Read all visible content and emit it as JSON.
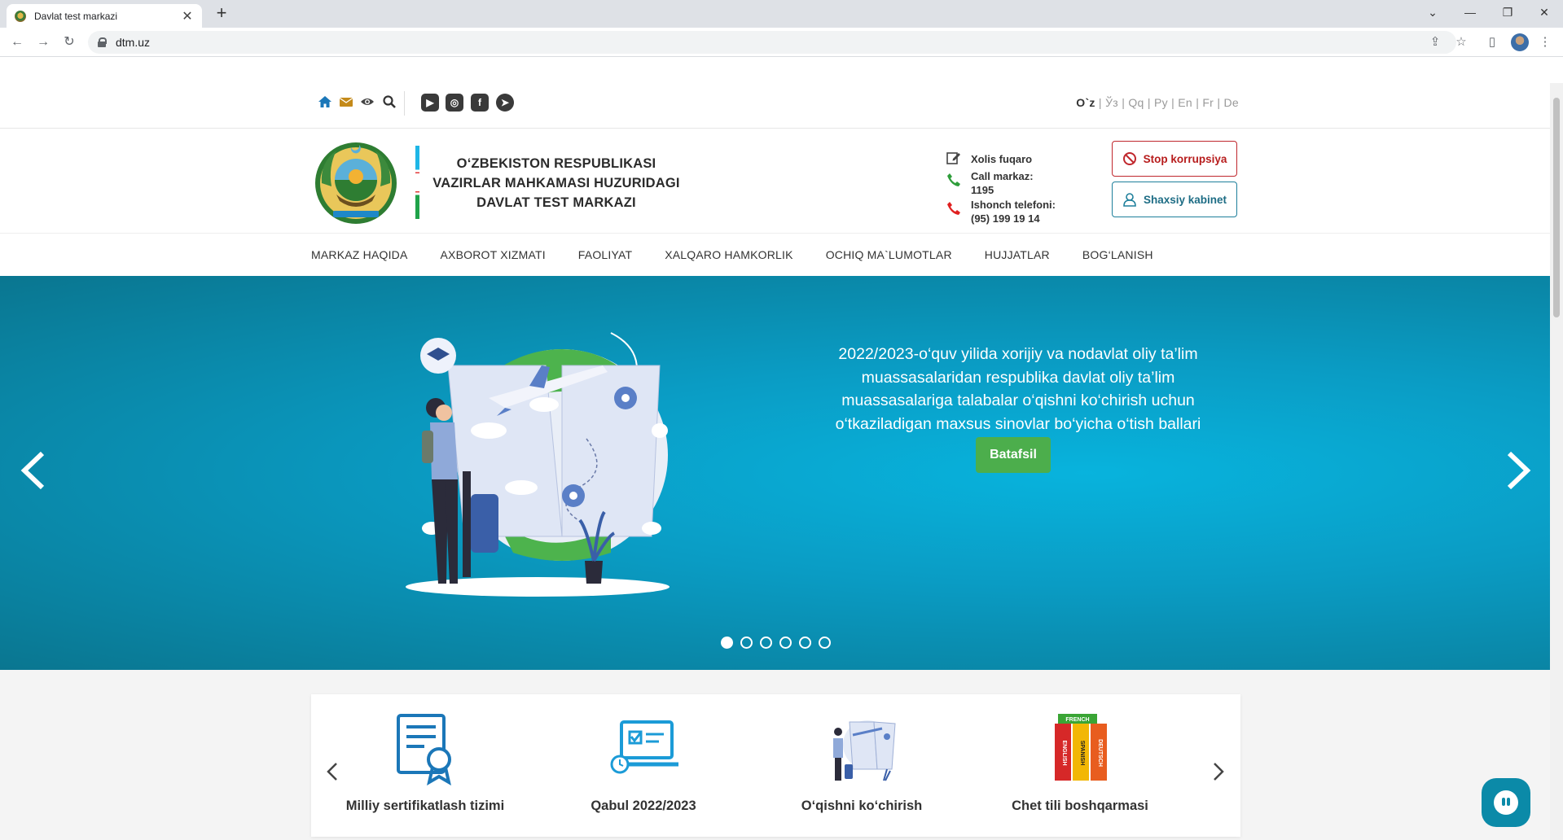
{
  "browser": {
    "tab_title": "Davlat test markazi",
    "url": "dtm.uz"
  },
  "topbar": {
    "languages": [
      "O`z",
      "Ўз",
      "Qq",
      "Ру",
      "En",
      "Fr",
      "De"
    ],
    "active_language": "O`z",
    "social_icons": [
      "youtube-icon",
      "instagram-icon",
      "facebook-icon",
      "telegram-icon"
    ],
    "utility_icons": [
      "home-icon",
      "mail-icon",
      "eye-icon",
      "search-icon"
    ]
  },
  "header": {
    "org_line1": "O‘ZBEKISTON RESPUBLIKASI",
    "org_line2": "VAZIRLAR MAHKAMASI HUZURIDAGI",
    "org_line3": "DAVLAT TEST MARKAZI",
    "contact": {
      "xolis": "Xolis fuqaro",
      "call_label": "Call markaz:",
      "call_value": "1195",
      "trust_label": "Ishonch telefoni:",
      "trust_value": "(95) 199 19 14"
    },
    "stop_label": "Stop korrupsiya",
    "cabinet_label": "Shaxsiy kabinet"
  },
  "nav": [
    {
      "label": "MARKAZ HAQIDA"
    },
    {
      "label": "AXBOROT XIZMATI"
    },
    {
      "label": "FAOLIYAT"
    },
    {
      "label": "XALQARO HAMKORLIK"
    },
    {
      "label": "OCHIQ MA`LUMOTLAR"
    },
    {
      "label": "HUJJATLAR"
    },
    {
      "label": "BOG‘LANISH"
    }
  ],
  "hero": {
    "line1": "2022/2023-o‘quv yilida xorijiy va nodavlat oliy ta’lim",
    "line2": "muassasalaridan respublika davlat oliy ta’lim",
    "line3": "muassasalariga talabalar o‘qishni ko‘chirish uchun",
    "line4": "o‘tkaziladigan maxsus sinovlar bo‘yicha o‘tish ballari",
    "button": "Batafsil",
    "slide_count": 6,
    "active_slide": 1
  },
  "cards": [
    {
      "label": "Milliy sertifikatlash tizimi",
      "icon": "certificate-icon"
    },
    {
      "label": "Qabul 2022/2023",
      "icon": "laptop-check-icon"
    },
    {
      "label": "O‘qishni ko‘chirish",
      "icon": "transfer-icon"
    },
    {
      "label": "Chet tili boshqarmasi",
      "icon": "books-icon"
    }
  ],
  "books": [
    "FRENCH",
    "ENGLISH",
    "SPANISH",
    "DEUTSCH"
  ],
  "colors": {
    "hero_center": "#08b3dd",
    "hero_edge": "#0a7690",
    "button_green": "#4cae4c",
    "stop_red": "#c0272d",
    "cabinet_teal": "#1e7f9b",
    "icon_blue": "#1b77b8"
  }
}
